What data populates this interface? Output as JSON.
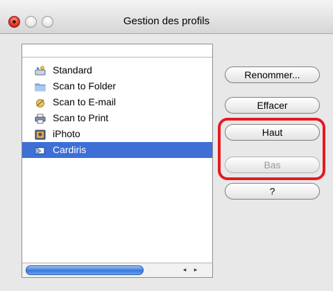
{
  "window": {
    "title": "Gestion des profils"
  },
  "profiles": [
    {
      "label": "Standard",
      "icon": "scanner-wizard-icon",
      "selected": false
    },
    {
      "label": "Scan to Folder",
      "icon": "folder-icon",
      "selected": false
    },
    {
      "label": "Scan to E-mail",
      "icon": "email-icon",
      "selected": false
    },
    {
      "label": "Scan to Print",
      "icon": "printer-icon",
      "selected": false
    },
    {
      "label": "iPhoto",
      "icon": "iphoto-icon",
      "selected": false
    },
    {
      "label": "Cardiris",
      "icon": "cardiris-icon",
      "selected": true
    }
  ],
  "buttons": {
    "rename": "Renommer...",
    "delete": "Effacer",
    "up": "Haut",
    "down": "Bas",
    "help": "?"
  },
  "colors": {
    "selection": "#3d6fd6",
    "highlight": "#e41a22"
  },
  "scrollbar": {
    "left_arrow": "◂",
    "right_arrow": "▸"
  }
}
